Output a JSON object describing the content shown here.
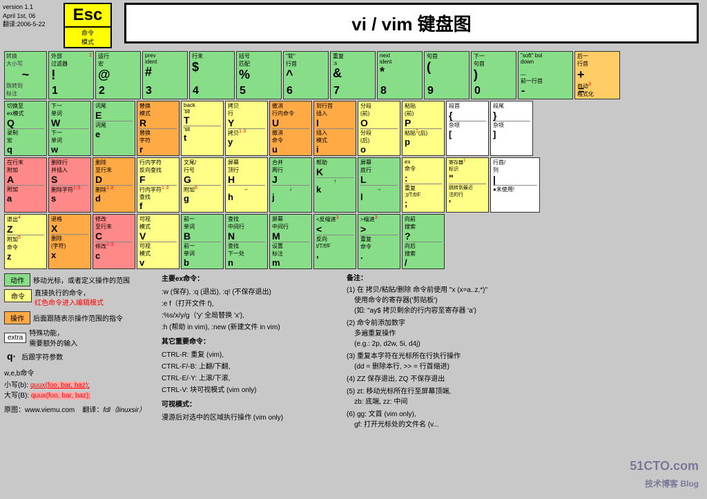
{
  "version": "version 1.1\nApril 1st, 06\n翻译:2006-5-22",
  "title": "vi / vim 键盘图",
  "esc": {
    "key": "Esc",
    "label": "命令\n模式"
  },
  "tilde_key": {
    "sym": "~",
    "top1": "转换",
    "top2": "大小写",
    "bot1": "跳转到",
    "bot2": "标注"
  },
  "num_row": [
    {
      "sym": "!",
      "desc_top": "外部",
      "desc_top2": "过滤器",
      "num": "1",
      "num_sup": "2"
    },
    {
      "sym": "@",
      "desc_top": "运行",
      "desc_top2": "宏",
      "num": "2"
    },
    {
      "sym": "#",
      "desc_top": "prev",
      "desc_top2": "ident",
      "num": "3"
    },
    {
      "sym": "$",
      "desc_top": "行末",
      "num": "4"
    },
    {
      "sym": "%",
      "desc_top": "括号",
      "desc_top2": "匹配",
      "num": "5"
    },
    {
      "sym": "^",
      "desc_top": "\"软\"",
      "desc_top2": "行首",
      "num": "6"
    },
    {
      "sym": "&",
      "desc_top": "重复",
      "desc_top2": ":s",
      "num": "7"
    },
    {
      "sym": "*",
      "desc_top": "next",
      "desc_top2": "ident",
      "num": "8"
    },
    {
      "sym": "(",
      "desc_top": "句首",
      "num": "9"
    },
    {
      "sym": ")",
      "desc_top": "下一",
      "desc_top2": "句首",
      "num": "0"
    },
    {
      "sym": "\"soft\" bol",
      "desc_bot": "down",
      "num": "-",
      "num_desc": "前一行首"
    },
    {
      "sym": "+",
      "desc_top": "后一",
      "desc_top2": "行首",
      "num": "=",
      "num_desc": "自动格式化",
      "num_sup": "3"
    }
  ],
  "qwerty_row": [
    {
      "upper": "Q",
      "lower": "q",
      "upper_desc": "切换至ex模式",
      "lower_desc": "录制宏",
      "color": "green"
    },
    {
      "upper": "W",
      "lower": "W",
      "upper_desc": "下一单词",
      "lower_desc": "下一单词",
      "upper_desc2": "",
      "lower_desc2": "",
      "color": "green"
    },
    {
      "upper": "E",
      "lower": "e",
      "upper_desc": "词尾",
      "lower_desc": "词尾",
      "color": "green"
    },
    {
      "upper": "R",
      "lower": "r",
      "upper_desc": "替换模式",
      "lower_desc": "替换字符",
      "color": "orange"
    },
    {
      "upper": "T",
      "lower": "t",
      "upper_desc": "back 'till",
      "lower_desc": "'till",
      "color": "yellow"
    },
    {
      "upper": "Y",
      "lower": "y",
      "upper_desc": "拷贝行",
      "lower_desc": "拷贝1·3",
      "color": "yellow"
    },
    {
      "upper": "U",
      "lower": "u",
      "upper_desc": "撤消行内命令",
      "lower_desc": "撤消命令",
      "color": "orange"
    },
    {
      "upper": "I",
      "lower": "i",
      "upper_desc": "到行首插入",
      "lower_desc": "插入模式",
      "color": "orange"
    },
    {
      "upper": "O",
      "lower": "o",
      "upper_desc": "分段(前)",
      "lower_desc": "分段(后)",
      "color": "yellow"
    },
    {
      "upper": "P",
      "lower": "p",
      "upper_desc": "粘贴(前)",
      "lower_desc": "粘贴1(后)",
      "color": "yellow"
    },
    {
      "upper": "{",
      "lower": "[",
      "upper_desc": "段首",
      "lower_desc": "杂项",
      "color": "white"
    },
    {
      "upper": "}",
      "lower": "]",
      "upper_desc": "段尾",
      "lower_desc": "杂项",
      "color": "white"
    }
  ],
  "legend": {
    "action": {
      "label": "动作",
      "color": "green",
      "desc": "移动光标，或者定义操作的范围"
    },
    "command": {
      "label": "命令",
      "color": "yellow",
      "desc": "直接执行的命令，\n红色命令进入编辑模式"
    },
    "operation": {
      "label": "操作",
      "color": "orange",
      "desc": "后面跟随表示操作范围的指令"
    },
    "extra": {
      "label": "extra",
      "color": "white",
      "border": true,
      "desc": "特殊功能，\n需要额外的输入"
    },
    "q_param": {
      "label": "q·",
      "desc": "后跟字符参数"
    }
  },
  "commands": {
    "title": "主要ex命令：",
    "items": [
      ":w (保存), :q (退出), :q! (不保存退出)",
      ":e f（打开文件 f),",
      ":%s/x/y/g（'y' 全局替换 'x'),",
      ":h (帮助 in vim), :new (新建文件 in vim)"
    ],
    "other_title": "其它重要命令：",
    "other_items": [
      "CTRL-R: 重复 (vim),",
      "CTRL-F/-B: 上翻/下翻,",
      "CTRL-E/-Y: 上滚/下滚,",
      "CTRL-V: 块可视模式 (vim only)"
    ],
    "visual_title": "可视模式：",
    "visual": "漫游后对选中的区域执行操作 (vim only)"
  },
  "notes": {
    "title": "备注：",
    "items": [
      "(1) 在 拷贝/粘贴/删除 命令前使用 \"x (x=a..z,*)\"\n     使用命令的寄存器('剪贴板')\n     (如: \"ay$ 拷贝剩余的行内容至寄存器 'a')",
      "(2) 命令前添加数字\n     多遍重复操作\n     (e.g.: 2p, d2w, 5i, d4j)",
      "(3) 重复本字符在光标所在行执行操作\n     (dd = 删除本行, >> = 行首缩进)",
      "(4) ZZ 保存退出, ZQ 不保存退出",
      "(5) zt: 移动光标所在行至屏幕顶端,\n     zb: 底端, zz: 中间",
      "(6) gg: 文首 (vim only),\n     gf: 打开光标处的文件名 (v..."
    ]
  },
  "bottom": {
    "source": "原图：www.viemu.com",
    "translator": "翻译：fdl（linuxsir）",
    "wb_command": "w,e,b命令",
    "lower_b": "小写(b):",
    "lower_b_example": "quux(foo, bar, baz);",
    "upper_b": "大写(B):",
    "upper_b_example": "quux(foo, bar, baz);"
  },
  "watermark": "51CTO.com\n技术博客 Blog"
}
